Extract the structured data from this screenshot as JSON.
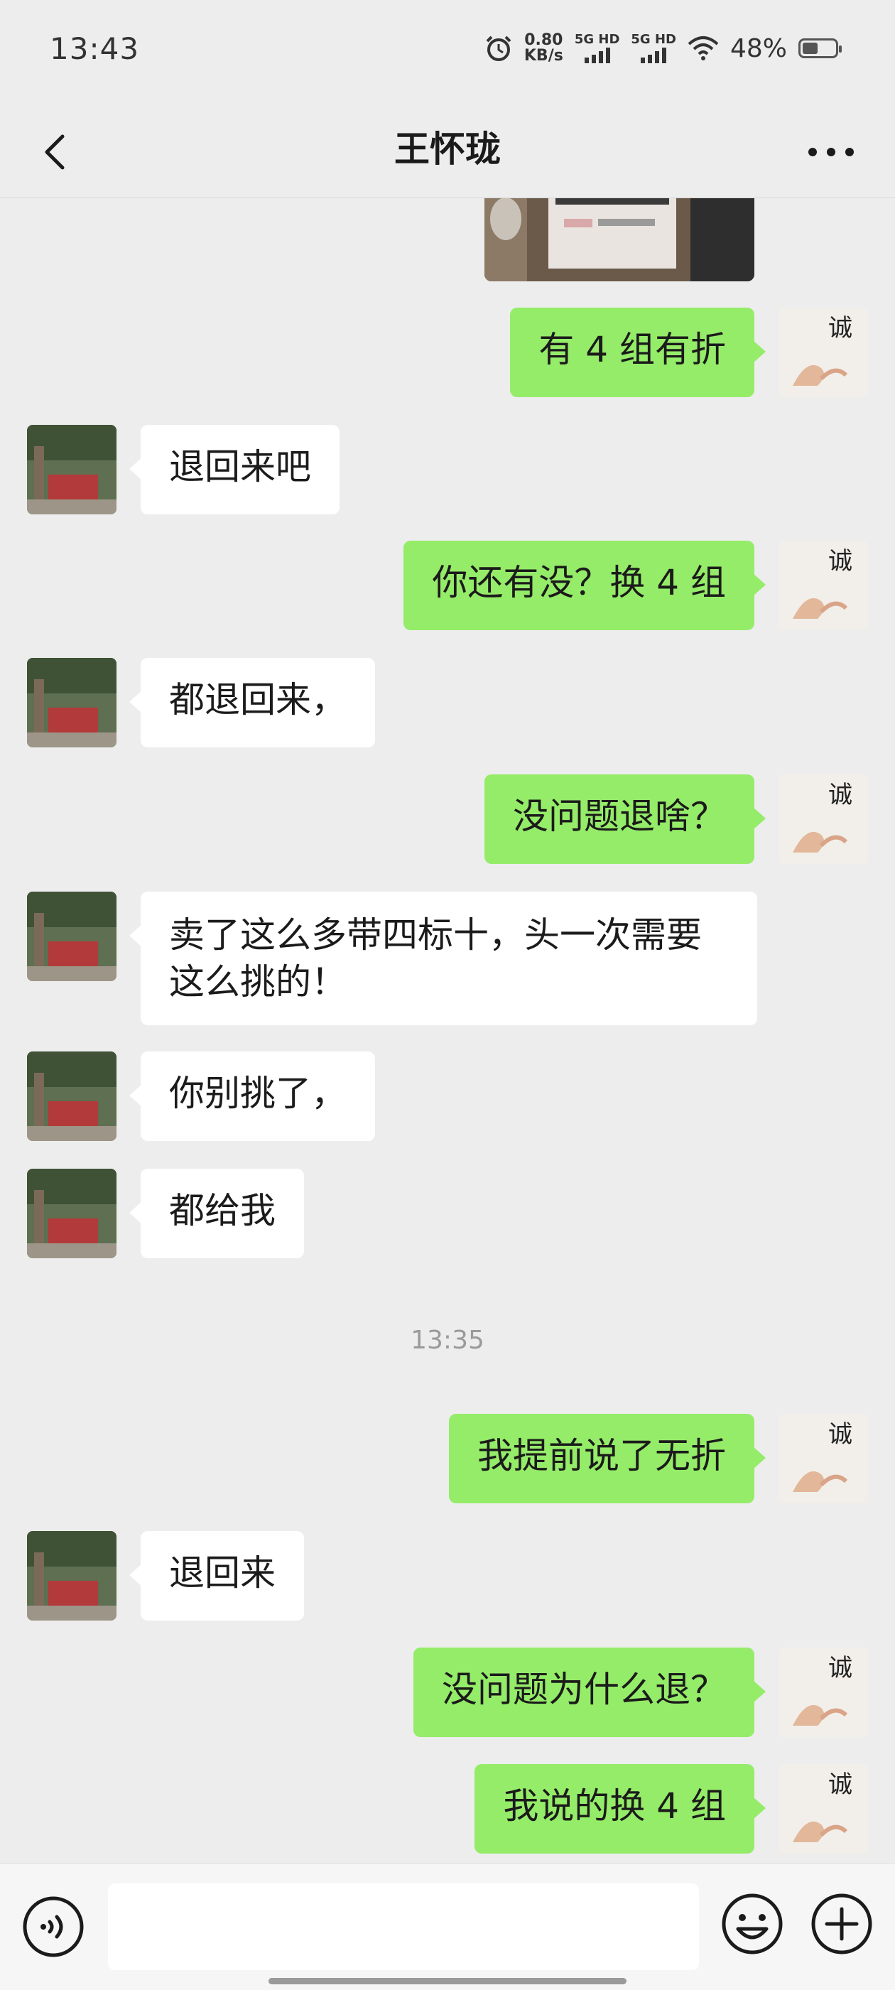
{
  "status_bar": {
    "time": "13:43",
    "net_speed_value": "0.80",
    "net_speed_unit": "KB/s",
    "signal1_label": "5G HD",
    "signal2_label": "5G HD",
    "battery_percent": "48%",
    "battery_level": 0.48,
    "icons": [
      "alarm-icon",
      "signal-icon",
      "wifi-icon",
      "battery-icon"
    ]
  },
  "nav": {
    "title": "王怀珑",
    "back_icon": "chevron-left-icon",
    "more_icon": "more-dots-icon"
  },
  "messages": [
    {
      "side": "out",
      "text": "有 4 组有折"
    },
    {
      "side": "in",
      "text": "退回来吧"
    },
    {
      "side": "out",
      "text": "你还有没？换 4 组"
    },
    {
      "side": "in",
      "text": "都退回来，"
    },
    {
      "side": "out",
      "text": "没问题退啥？"
    },
    {
      "side": "in",
      "text": "卖了这么多带四标十，头一次需要这么挑的！"
    },
    {
      "side": "in",
      "text": "你别挑了，"
    },
    {
      "side": "in",
      "text": "都给我"
    },
    {
      "timestamp": "13:35"
    },
    {
      "side": "out",
      "text": "我提前说了无折"
    },
    {
      "side": "in",
      "text": "退回来"
    },
    {
      "side": "out",
      "text": "没问题为什么退？"
    },
    {
      "side": "out",
      "text": "我说的换 4 组"
    }
  ],
  "input_bar": {
    "input_value": "",
    "icons": [
      "voice-icon",
      "emoji-icon",
      "plus-icon"
    ]
  },
  "colors": {
    "background": "#ededed",
    "outgoing_bubble": "#95ec69",
    "incoming_bubble": "#ffffff"
  }
}
